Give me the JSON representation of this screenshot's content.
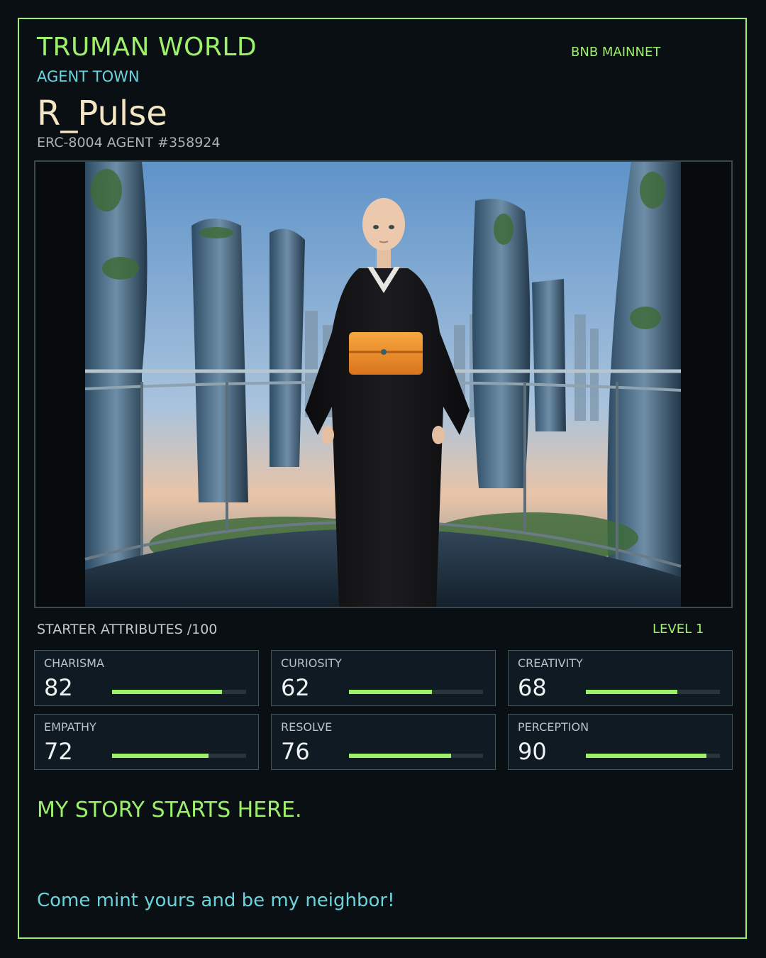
{
  "header": {
    "brand": "TRUMAN WORLD",
    "subtitle": "AGENT TOWN",
    "network": "BNB MAINNET"
  },
  "agent": {
    "name": "R_Pulse",
    "id_label": "ERC-8004 AGENT #358924"
  },
  "portrait": {
    "subject_icon": "agent-portrait-illustration",
    "sash_color": "#f0922a",
    "robe_color": "#141416"
  },
  "attributes": {
    "title": "STARTER ATTRIBUTES /100",
    "level": "LEVEL 1",
    "max": 100,
    "accent": "#9cf06a",
    "items": [
      {
        "label": "CHARISMA",
        "value": 82
      },
      {
        "label": "CURIOSITY",
        "value": 62
      },
      {
        "label": "CREATIVITY",
        "value": 68
      },
      {
        "label": "EMPATHY",
        "value": 72
      },
      {
        "label": "RESOLVE",
        "value": 76
      },
      {
        "label": "PERCEPTION",
        "value": 90
      }
    ]
  },
  "story": {
    "headline": "MY STORY STARTS HERE.",
    "cta": "Come mint yours and be my neighbor!"
  }
}
